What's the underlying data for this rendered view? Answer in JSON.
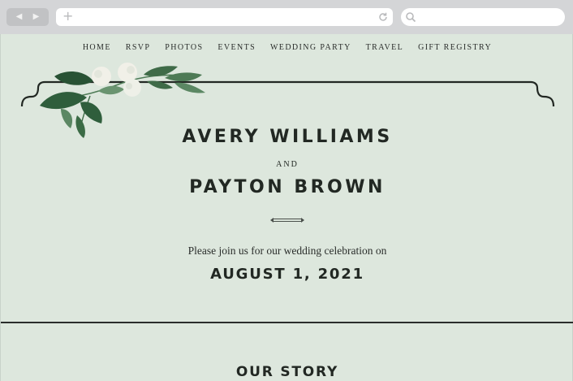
{
  "browser": {
    "back_icon": "back-arrow-icon",
    "forward_icon": "forward-arrow-icon",
    "new_tab_icon": "plus-icon",
    "reload_icon": "reload-icon",
    "search_icon": "search-icon",
    "url": "",
    "search_value": ""
  },
  "nav": {
    "items": [
      "HOME",
      "RSVP",
      "PHOTOS",
      "EVENTS",
      "WEDDING PARTY",
      "TRAVEL",
      "GIFT REGISTRY"
    ]
  },
  "hero": {
    "name1": "AVERY WILLIAMS",
    "and": "AND",
    "name2": "PAYTON BROWN",
    "invite": "Please join us for our wedding celebration on",
    "date": "AUGUST 1, 2021"
  },
  "section": {
    "title": "OUR STORY"
  },
  "colors": {
    "page_background": "#dde7dd",
    "text": "#222823",
    "chrome": "#d4d5d7",
    "leaf_green": "#2f5e3c",
    "flower": "#f1f0e8"
  }
}
